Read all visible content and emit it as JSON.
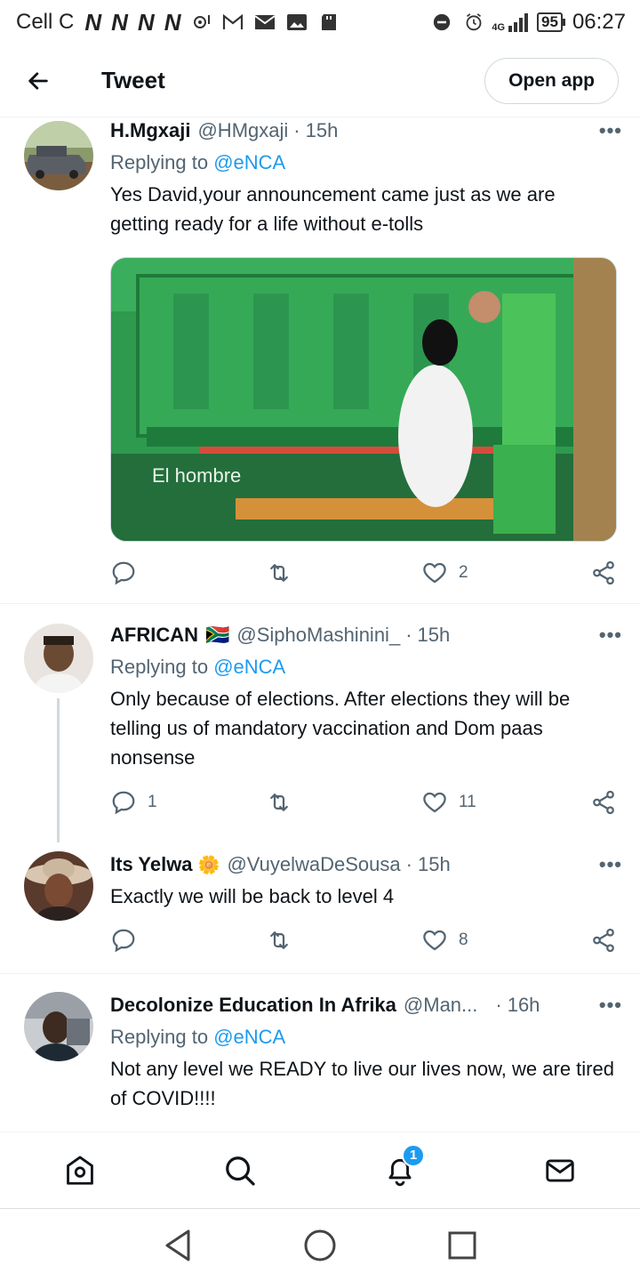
{
  "status_bar": {
    "carrier": "Cell C",
    "n_icons": [
      "N",
      "N",
      "N",
      "N"
    ],
    "network": "4G",
    "battery": "95",
    "time": "06:27"
  },
  "header": {
    "title": "Tweet",
    "open_app": "Open app"
  },
  "tweets": [
    {
      "name": "H.Mgxaji",
      "handle": "@HMgxaji",
      "dot": "·",
      "time": "15h",
      "replying_prefix": "Replying to ",
      "replying_to": "@eNCA",
      "text": "Yes David,your announcement came just as we are getting ready for a life without e-tolls",
      "media_caption": "El hombre",
      "replies": "",
      "retweets": "",
      "likes": "2"
    },
    {
      "name": "AFRICAN",
      "flag": "🇿🇦",
      "handle": "@SiphoMashinini_",
      "dot": "·",
      "time": "15h",
      "replying_prefix": "Replying to ",
      "replying_to": "@eNCA",
      "text": "Only because of elections. After elections they will be telling us of mandatory vaccination and Dom paas nonsense",
      "replies": "1",
      "retweets": "",
      "likes": "11"
    },
    {
      "name": "Its Yelwa",
      "emoji": "🌼",
      "handle": "@VuyelwaDeSousa",
      "dot": "·",
      "time": "15h",
      "text": "Exactly we will be back to level 4",
      "replies": "",
      "retweets": "",
      "likes": "8"
    },
    {
      "name": "Decolonize Education In Afrika",
      "handle": "@Man...",
      "dot": "·",
      "time": "16h",
      "replying_prefix": "Replying to ",
      "replying_to": "@eNCA",
      "text": "Not any level we READY to live our lives now, we are tired of COVID!!!!"
    }
  ],
  "bottom_nav": {
    "notification_badge": "1"
  },
  "colors": {
    "accent": "#1d9bf0",
    "secondary_text": "#536471",
    "primary_text": "#0f1419"
  }
}
